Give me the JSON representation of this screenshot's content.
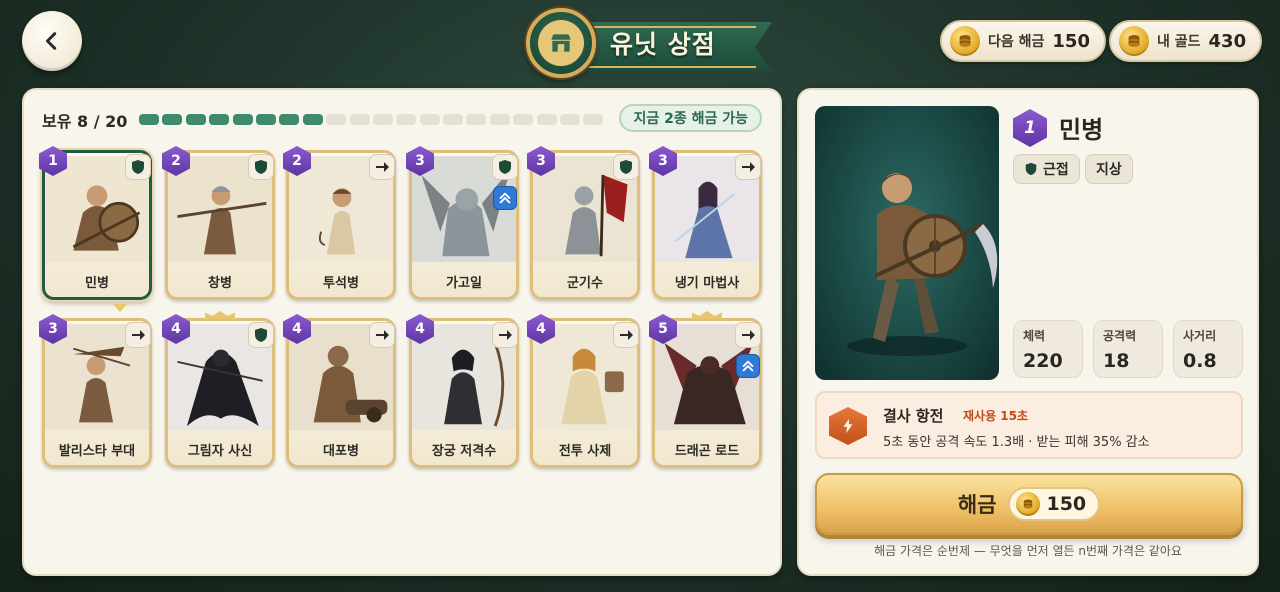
{
  "header": {
    "title": "유닛 상점",
    "next_unlock_label": "다음 해금",
    "next_unlock_value": "150",
    "my_gold_label": "내 골드",
    "my_gold_value": "430"
  },
  "roster": {
    "owned_label": "보유 8 / 20",
    "owned_count": 8,
    "total_slots": 20,
    "available_badge": "지금 2종 해금 가능"
  },
  "units": [
    {
      "name": "민병",
      "tier": "1",
      "tag": "shield-icon",
      "selected": true
    },
    {
      "name": "창병",
      "tier": "2",
      "tag": "shield-icon"
    },
    {
      "name": "투석병",
      "tier": "2",
      "tag": "arrow-right-icon"
    },
    {
      "name": "가고일",
      "tier": "3",
      "tag": "shield-icon",
      "promo": "chevron-up-double-icon"
    },
    {
      "name": "군기수",
      "tier": "3",
      "tag": "shield-icon"
    },
    {
      "name": "냉기 마법사",
      "tier": "3",
      "tag": "arrow-right-icon"
    },
    {
      "name": "발리스타 부대",
      "tier": "3",
      "tag": "arrow-right-icon"
    },
    {
      "name": "그림자 사신",
      "tier": "4",
      "tag": "shield-icon"
    },
    {
      "name": "대포병",
      "tier": "4",
      "tag": "arrow-right-icon"
    },
    {
      "name": "장궁 저격수",
      "tier": "4",
      "tag": "arrow-right-icon"
    },
    {
      "name": "전투 사제",
      "tier": "4",
      "tag": "arrow-right-icon"
    },
    {
      "name": "드래곤 로드",
      "tier": "5",
      "tag": "arrow-right-icon",
      "promo": "chevron-up-double-icon"
    }
  ],
  "detail": {
    "tier": "1",
    "name": "민병",
    "chips": [
      "근접",
      "지상"
    ],
    "stats": [
      {
        "label": "체력",
        "value": "220"
      },
      {
        "label": "공격력",
        "value": "18"
      },
      {
        "label": "사거리",
        "value": "0.8"
      }
    ],
    "skill": {
      "title": "결사 항전",
      "cooldown": "재사용 15초",
      "description": "5초 동안 공격 속도 1.3배 · 받는 피해 35% 감소"
    },
    "buy_label": "해금",
    "price": "150",
    "footnote": "해금 가격은 순번제 — 무엇을 먼저 열든 n번째 가격은 같아요"
  },
  "colors": {
    "accent_green": "#3f8a6c",
    "tier_purple": "#6a3fb5",
    "gold": "#e0a521",
    "skill_orange": "#c34f18"
  }
}
